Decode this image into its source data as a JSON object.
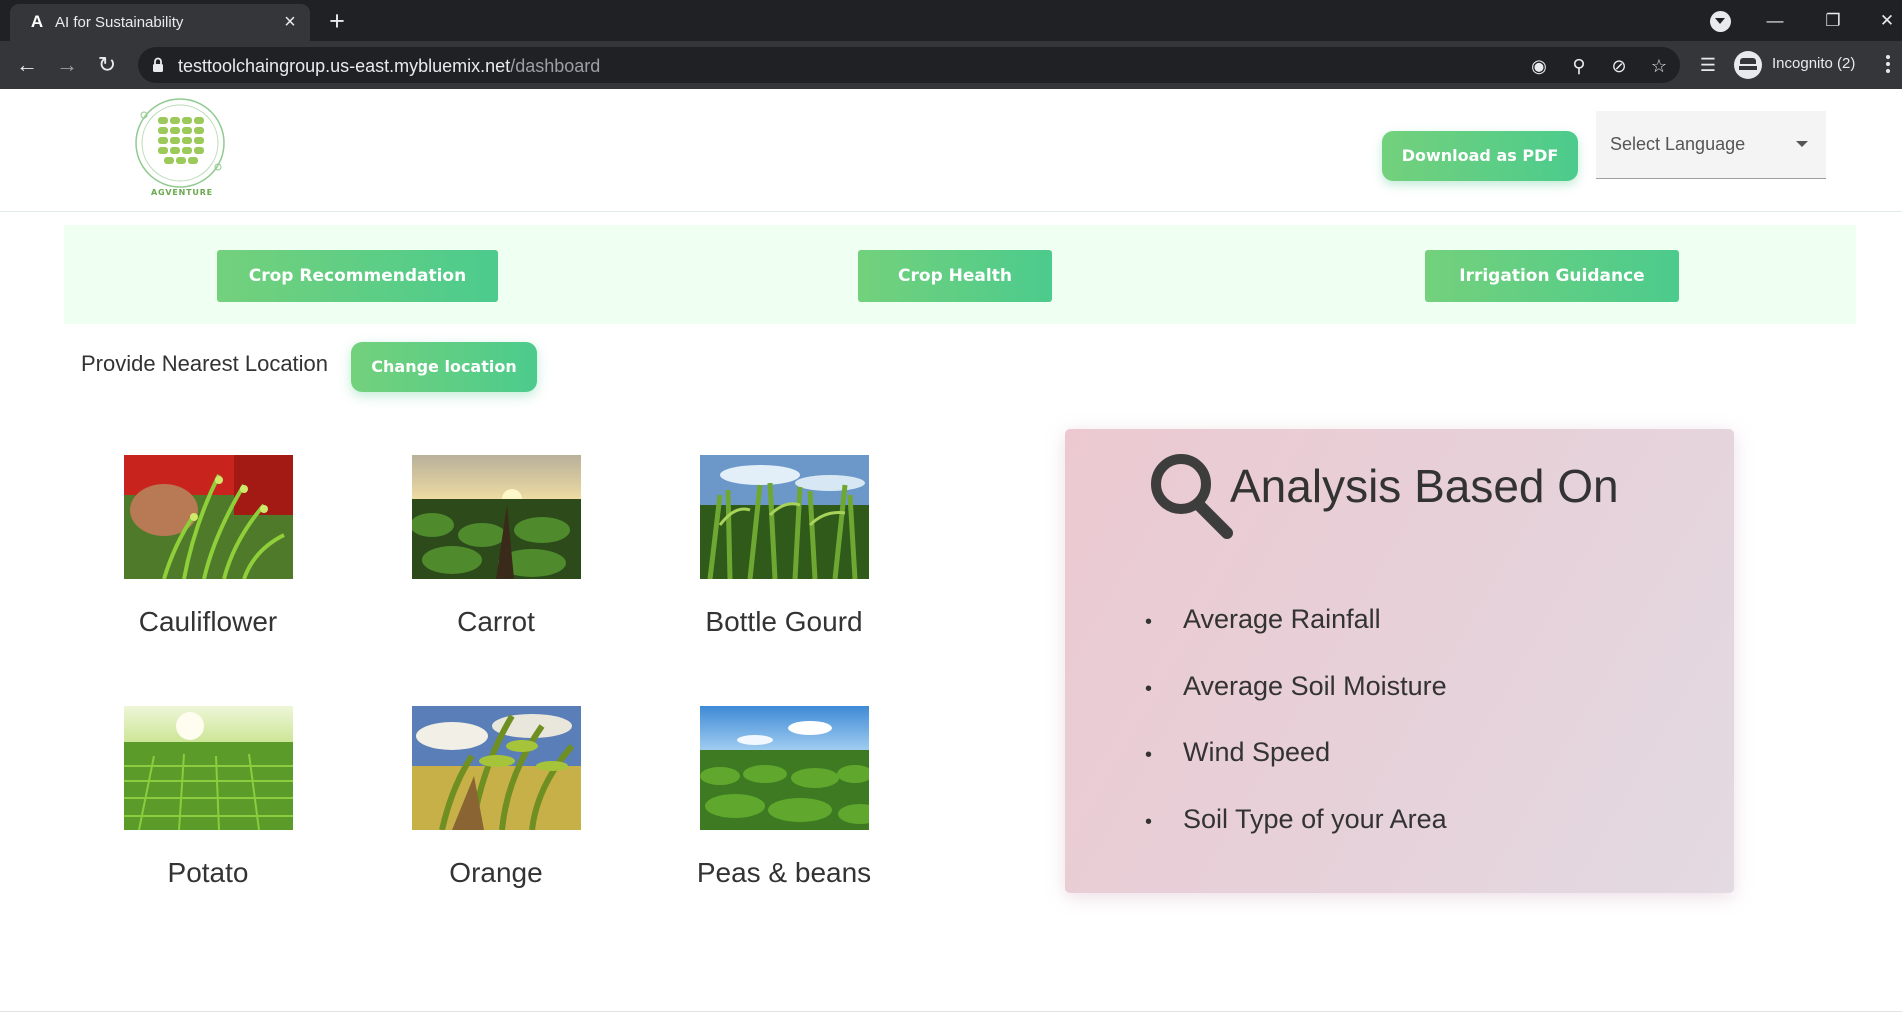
{
  "browser": {
    "tab_title": "AI for Sustainability",
    "tab_favicon": "A",
    "tab_close": "×",
    "new_tab": "+",
    "url_host": "testtoolchaingroup.us-east.mybluemix.net",
    "url_path": "/dashboard",
    "profile_label": "Incognito (2)",
    "icons": [
      "back-icon",
      "forward-icon",
      "reload-icon",
      "lock-icon",
      "blocked-icon",
      "zoom-icon",
      "eye-off-icon",
      "star-icon",
      "reading-list-icon",
      "incognito-icon",
      "kebab-icon",
      "minimize-icon",
      "restore-icon",
      "close-icon"
    ]
  },
  "header": {
    "logo_text": "AGVENTURE",
    "download_label": "Download as PDF",
    "language_placeholder": "Select Language"
  },
  "nav": {
    "tabs": [
      {
        "label": "Crop Recommendation"
      },
      {
        "label": "Crop Health"
      },
      {
        "label": "Irrigation Guidance"
      }
    ]
  },
  "location": {
    "label": "Provide Nearest Location",
    "button_label": "Change location"
  },
  "crops": [
    {
      "name": "Cauliflower"
    },
    {
      "name": "Carrot"
    },
    {
      "name": "Bottle Gourd"
    },
    {
      "name": "Potato"
    },
    {
      "name": "Orange"
    },
    {
      "name": "Peas & beans"
    }
  ],
  "analysis": {
    "title": "Analysis Based On",
    "bullet": "•",
    "factors": [
      {
        "label": "Average Rainfall"
      },
      {
        "label": "Average Soil Moisture"
      },
      {
        "label": "Wind Speed"
      },
      {
        "label": "Soil Type of your Area"
      }
    ]
  },
  "colors": {
    "accent_start": "#73d17c",
    "accent_end": "#4ccb8d",
    "nav_band": "#effff2",
    "analysis_bg": "#ecc9d1"
  }
}
